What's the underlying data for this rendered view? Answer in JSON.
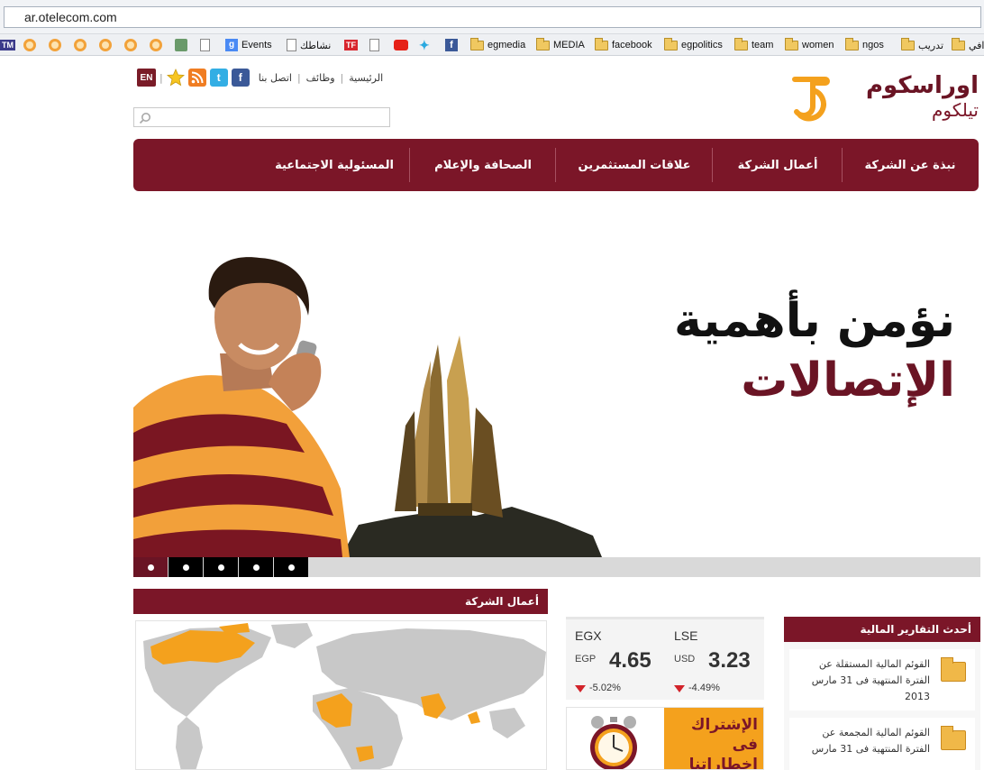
{
  "browser": {
    "url": "ar.otelecom.com",
    "bookmarks": [
      {
        "label": "Events",
        "icon": "google-icon"
      },
      {
        "label": "نشاطك",
        "icon": "page-icon"
      },
      {
        "label": "egmedia",
        "icon": "folder-icon"
      },
      {
        "label": "MEDIA",
        "icon": "folder-icon"
      },
      {
        "label": "facebook",
        "icon": "folder-icon"
      },
      {
        "label": "egpolitics",
        "icon": "folder-icon"
      },
      {
        "label": "team",
        "icon": "folder-icon"
      },
      {
        "label": "women",
        "icon": "folder-icon"
      },
      {
        "label": "ngos",
        "icon": "folder-icon"
      },
      {
        "label": "تدريب",
        "icon": "folder-icon"
      },
      {
        "label": "افي",
        "icon": "folder-icon"
      }
    ],
    "left_label": "TM",
    "tf_label": "TF"
  },
  "header": {
    "lang_button": "EN",
    "links": [
      "الرئيسية",
      "وظائف",
      "اتصل بنا"
    ],
    "logo_top": "اوراسكوم",
    "logo_bottom": "تيلكوم",
    "search_placeholder": ""
  },
  "nav": {
    "items": [
      "نبذة عن الشركة",
      "أعمال الشركة",
      "علاقات المستثمرين",
      "الصحافة والإعلام",
      "المسئولية الاجتماعية"
    ]
  },
  "hero": {
    "line1": "نؤمن بأهمية",
    "line2": "الإتصالات",
    "slides_count": 5,
    "active_slide": 1
  },
  "sections": {
    "operations_title": "أعمال الشركة",
    "reports_title": "أحدث التقارير المالية"
  },
  "stocks": [
    {
      "exchange": "EGX",
      "currency": "EGP",
      "price": "4.65",
      "change": "-5.02%"
    },
    {
      "exchange": "LSE",
      "currency": "USD",
      "price": "3.23",
      "change": "-4.49%"
    }
  ],
  "promo": {
    "text": "الإشتراك فى إخطاراتنا"
  },
  "reports": [
    {
      "text": "القوئم المالية المستقلة عن الفترة المنتهية فى 31 مارس 2013"
    },
    {
      "text": "القوئم المالية المجمعة عن الفترة المنتهية فى 31 مارس"
    }
  ],
  "colors": {
    "brand": "#7b1628",
    "accent": "#f4a11d",
    "down": "#d2232a"
  }
}
